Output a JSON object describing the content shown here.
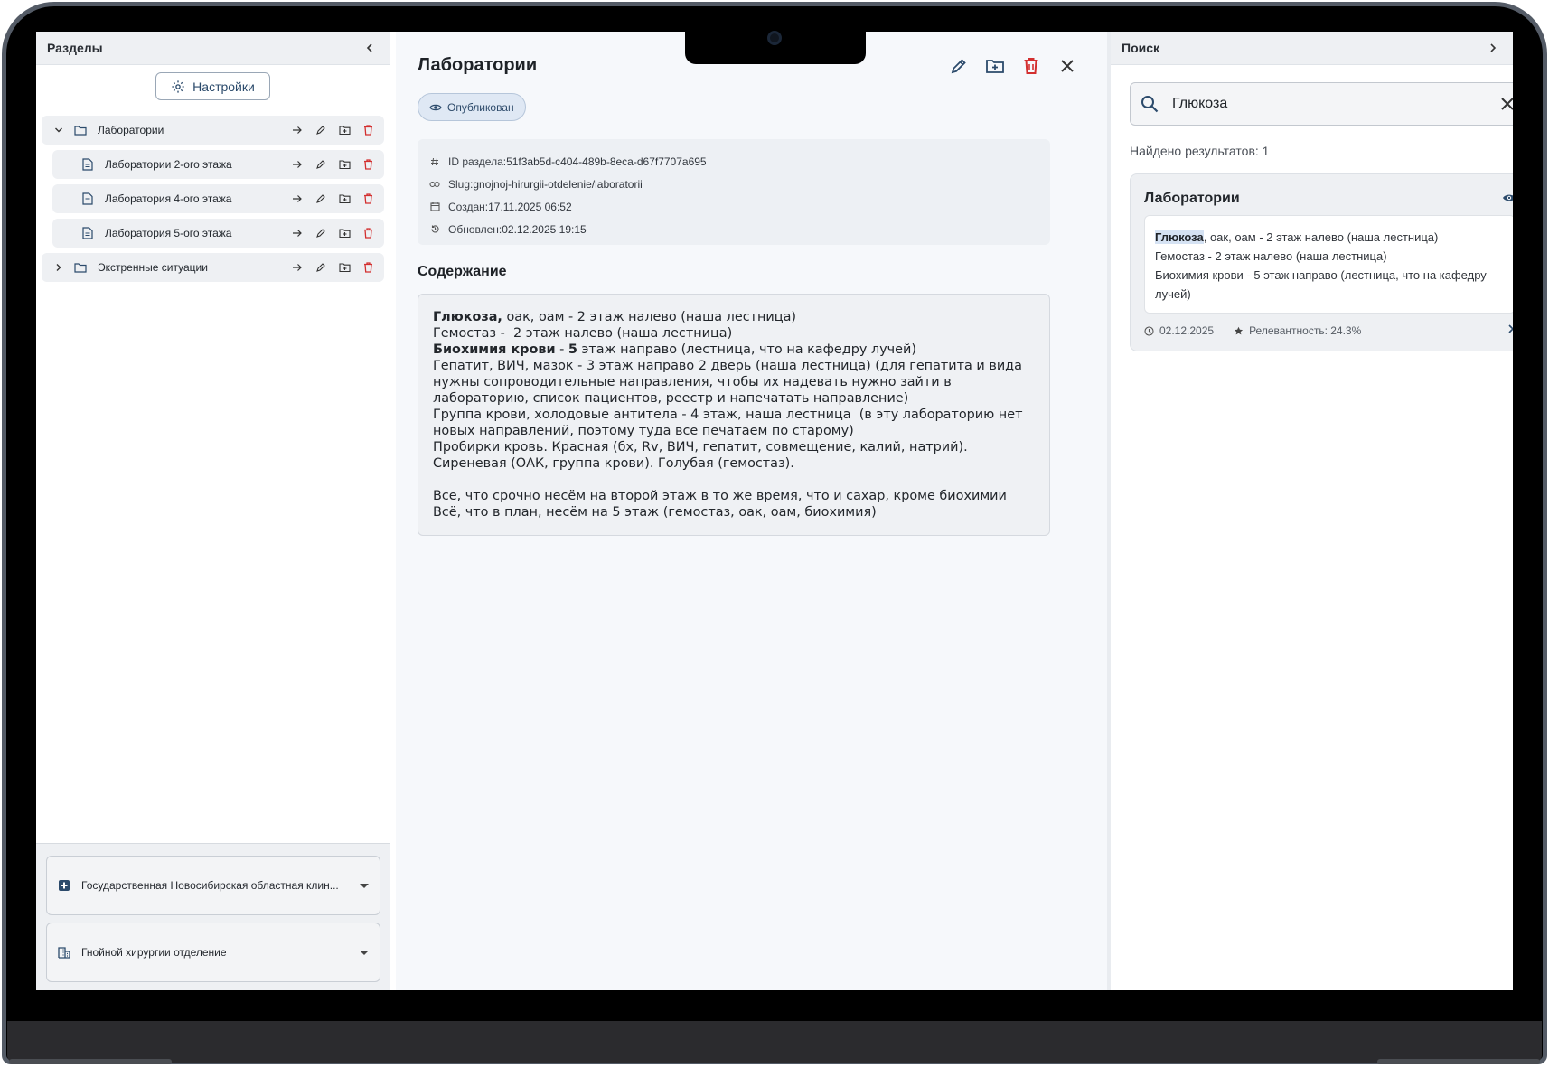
{
  "left_panel": {
    "title": "Разделы",
    "settings_label": "Настройки",
    "tree": [
      {
        "label": "Лаборатории",
        "level": 0,
        "kind": "folder",
        "expanded": true
      },
      {
        "label": "Лаборатории 2-ого этажа",
        "level": 1,
        "kind": "document"
      },
      {
        "label": "Лаборатория 4-ого этажа",
        "level": 1,
        "kind": "document"
      },
      {
        "label": "Лаборатория 5-ого этажа",
        "level": 1,
        "kind": "document"
      },
      {
        "label": "Экстренные ситуации",
        "level": 0,
        "kind": "folder",
        "expanded": false
      }
    ],
    "organization": "Государственная Новосибирская областная клин...",
    "department": "Гнойной хирургии отделение"
  },
  "main": {
    "title": "Лаборатории",
    "status": "Опубликован",
    "meta": {
      "id_label": "ID раздела: ",
      "id_value": "51f3ab5d-c404-489b-8eca-d67f7707a695",
      "slug_label": "Slug: ",
      "slug_value": "gnojnoj-hirurgii-otdelenie/laboratorii",
      "created_label": "Создан: ",
      "created_value": "17.11.2025 06:52",
      "updated_label": "Обновлен: ",
      "updated_value": "02.12.2025 19:15"
    },
    "content_title": "Содержание",
    "content": {
      "l1_bold": "Глюкоза,",
      "l1_rest": " оак, оам - 2 этаж налево (наша лестница)",
      "l2": "Гемостаз -  2 этаж налево (наша лестница)",
      "l3_bold_a": "Биохимия крови",
      "l3_mid": " - ",
      "l3_bold_b": "5",
      "l3_rest": " этаж направо (лестница, что на кафедру лучей)",
      "l4": "Гепатит, ВИЧ, мазок - 3 этаж направо 2 дверь (наша лестница) (для гепатита и вида нужны сопроводительные направления, чтобы их надевать нужно зайти в лабораторию, список пациентов, реестр и напечатать направление)",
      "l5": "Группа крови, холодовые антитела - 4 этаж, наша лестница  (в эту лабораторию нет новых направлений, поэтому туда все печатаем по старому)",
      "l6": "Пробирки кровь. Красная (бх, Rv, ВИЧ, гепатит, совмещение, калий, натрий). Сиреневая (ОАК, группа крови). Голубая (гемостаз).",
      "l7": "Все, что срочно несём на второй этаж в то же время, что и сахар, кроме биохимии",
      "l8": "Всё, что в план, несём на 5 этаж (гемостаз, оак, оам, биохимия)"
    }
  },
  "search": {
    "title": "Поиск",
    "query": "Глюкоза",
    "result_count": "Найдено результатов: 1",
    "result": {
      "title": "Лаборатории",
      "snippet_highlight": "Глюкоза",
      "snippet_l1": ", оак, оам - 2 этаж налево (наша лестница)",
      "snippet_l2": "Гемостаз -  2 этаж налево (наша лестница)",
      "snippet_l3": "Биохимия крови - 5 этаж направо (лестница, что на кафедру лучей)",
      "date": "02.12.2025",
      "relevance": "Релевантность: 24.3%"
    }
  },
  "colors": {
    "accent": "#2b4a6b",
    "danger": "#d32f2f",
    "highlight": "#d5e2f3"
  }
}
